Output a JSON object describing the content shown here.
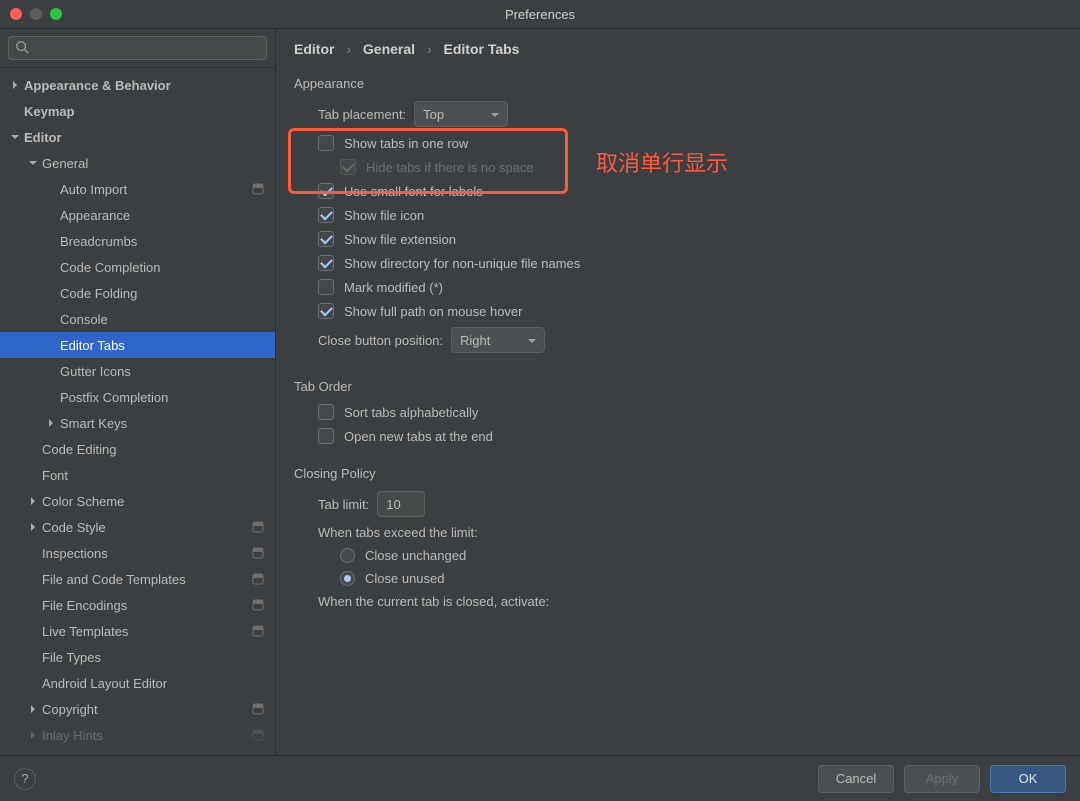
{
  "window": {
    "title": "Preferences"
  },
  "search": {
    "placeholder": ""
  },
  "sidebar": {
    "items": [
      {
        "label": "Appearance & Behavior",
        "indent": 1,
        "arrow": "right",
        "bold": true
      },
      {
        "label": "Keymap",
        "indent": 1,
        "arrow": "",
        "bold": true
      },
      {
        "label": "Editor",
        "indent": 1,
        "arrow": "down",
        "bold": true
      },
      {
        "label": "General",
        "indent": 2,
        "arrow": "down"
      },
      {
        "label": "Auto Import",
        "indent": 3,
        "arrow": "",
        "badge": true
      },
      {
        "label": "Appearance",
        "indent": 3,
        "arrow": ""
      },
      {
        "label": "Breadcrumbs",
        "indent": 3,
        "arrow": ""
      },
      {
        "label": "Code Completion",
        "indent": 3,
        "arrow": ""
      },
      {
        "label": "Code Folding",
        "indent": 3,
        "arrow": ""
      },
      {
        "label": "Console",
        "indent": 3,
        "arrow": ""
      },
      {
        "label": "Editor Tabs",
        "indent": 3,
        "arrow": "",
        "selected": true
      },
      {
        "label": "Gutter Icons",
        "indent": 3,
        "arrow": ""
      },
      {
        "label": "Postfix Completion",
        "indent": 3,
        "arrow": ""
      },
      {
        "label": "Smart Keys",
        "indent": 3,
        "arrow": "right"
      },
      {
        "label": "Code Editing",
        "indent": 2,
        "arrow": ""
      },
      {
        "label": "Font",
        "indent": 2,
        "arrow": ""
      },
      {
        "label": "Color Scheme",
        "indent": 2,
        "arrow": "right"
      },
      {
        "label": "Code Style",
        "indent": 2,
        "arrow": "right",
        "badge": true
      },
      {
        "label": "Inspections",
        "indent": 2,
        "arrow": "",
        "badge": true
      },
      {
        "label": "File and Code Templates",
        "indent": 2,
        "arrow": "",
        "badge": true
      },
      {
        "label": "File Encodings",
        "indent": 2,
        "arrow": "",
        "badge": true
      },
      {
        "label": "Live Templates",
        "indent": 2,
        "arrow": "",
        "badge": true
      },
      {
        "label": "File Types",
        "indent": 2,
        "arrow": ""
      },
      {
        "label": "Android Layout Editor",
        "indent": 2,
        "arrow": ""
      },
      {
        "label": "Copyright",
        "indent": 2,
        "arrow": "right",
        "badge": true
      },
      {
        "label": "Inlay Hints",
        "indent": 2,
        "arrow": "right",
        "badge": true,
        "cut": true
      }
    ]
  },
  "breadcrumb": {
    "a": "Editor",
    "b": "General",
    "c": "Editor Tabs"
  },
  "appearance": {
    "heading": "Appearance",
    "tab_placement_label": "Tab placement:",
    "tab_placement_value": "Top",
    "show_tabs_one_row": "Show tabs in one row",
    "hide_tabs_no_space": "Hide tabs if there is no space",
    "use_small_font": "Use small font for labels",
    "show_file_icon": "Show file icon",
    "show_file_ext": "Show file extension",
    "show_dir_nonunique": "Show directory for non-unique file names",
    "mark_modified": "Mark modified (*)",
    "show_full_path": "Show full path on mouse hover",
    "close_btn_pos_label": "Close button position:",
    "close_btn_pos_value": "Right"
  },
  "tab_order": {
    "heading": "Tab Order",
    "sort_alpha": "Sort tabs alphabetically",
    "open_at_end": "Open new tabs at the end"
  },
  "closing": {
    "heading": "Closing Policy",
    "tab_limit_label": "Tab limit:",
    "tab_limit_value": "10",
    "exceed_label": "When tabs exceed the limit:",
    "close_unchanged": "Close unchanged",
    "close_unused": "Close unused",
    "when_closed_label": "When the current tab is closed, activate:"
  },
  "annotation": {
    "text": "取消单行显示"
  },
  "footer": {
    "help": "?",
    "cancel": "Cancel",
    "apply": "Apply",
    "ok": "OK"
  }
}
